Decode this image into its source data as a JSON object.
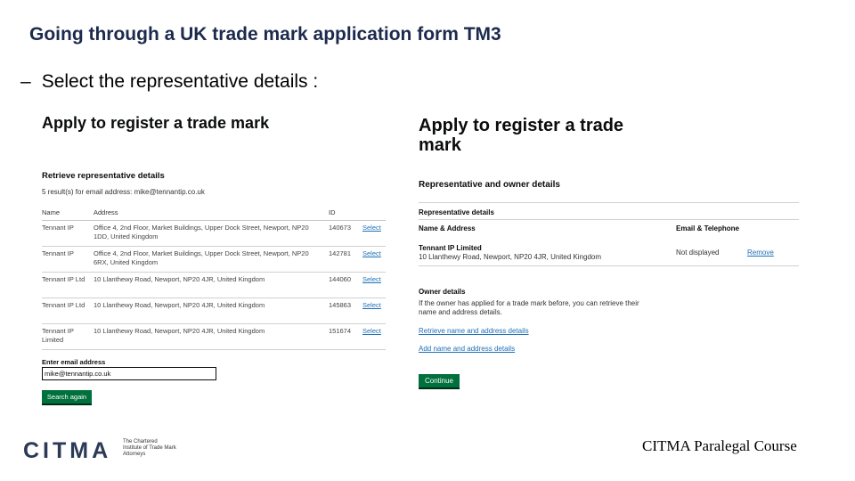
{
  "slide": {
    "title": "Going through a UK trade mark application form TM3",
    "bullet_dash": "–",
    "bullet": "Select the representative details :"
  },
  "left_screen": {
    "heading": "Apply to register a trade mark",
    "subheading": "Retrieve representative details",
    "result_text": "5 result(s) for email address: mike@tennantip.co.uk",
    "columns": [
      "Name",
      "Address",
      "ID"
    ],
    "rows": [
      {
        "name": "Tennant IP",
        "address": "Office 4, 2nd Floor, Market Buildings, Upper Dock Street, Newport, NP20 1DD, United Kingdom",
        "id": "140673",
        "action": "Select"
      },
      {
        "name": "Tennant IP",
        "address": "Office 4, 2nd Floor, Market Buildings, Upper Dock Street, Newport, NP20 6RX, United Kingdom",
        "id": "142781",
        "action": "Select"
      },
      {
        "name": "Tennant IP Ltd",
        "address": "10 Llanthewy Road, Newport, NP20 4JR, United Kingdom",
        "id": "144060",
        "action": "Select"
      },
      {
        "name": "Tennant IP Ltd",
        "address": "10 Llanthewy Road, Newport, NP20 4JR, United Kingdom",
        "id": "145863",
        "action": "Select"
      },
      {
        "name": "Tennant IP Limited",
        "address": "10 Llanthewy Road, Newport, NP20 4JR, United Kingdom",
        "id": "151674",
        "action": "Select"
      }
    ],
    "email_label": "Enter email address",
    "email_value": "mike@tennantip.co.uk",
    "search_button": "Search again"
  },
  "right_screen": {
    "heading": "Apply to register a trade mark",
    "subheading": "Representative and owner details",
    "rep_heading": "Representative details",
    "col_name_address": "Name & Address",
    "col_email_tel": "Email & Telephone",
    "rep_name": "Tennant IP Limited",
    "rep_address": "10 Llanthewy Road, Newport, NP20 4JR, United Kingdom",
    "rep_contact": "Not displayed",
    "remove_link": "Remove",
    "owner_heading": "Owner details",
    "owner_text": "If the owner has applied for a trade mark before, you can retrieve their name and address details.",
    "retrieve_link": "Retrieve name and address details",
    "add_link": "Add name and address details",
    "continue_button": "Continue"
  },
  "footer": {
    "logo_text": "CITMA",
    "logo_sub": "The Chartered Institute of Trade Mark Attorneys",
    "right_text": "CITMA Paralegal Course"
  },
  "colors": {
    "title": "#1d2a4d",
    "button_green": "#00703c",
    "link_blue": "#1d70b8"
  }
}
